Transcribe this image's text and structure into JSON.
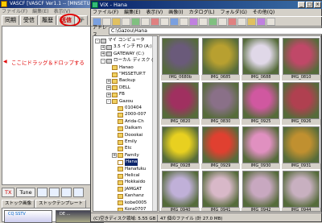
{
  "left_app": {
    "title": "VASCF [VASCF Ver1.1 -- [MNSETUP.TXT] ]",
    "menu": "ファイル(F)　編集(E)　表示(V)",
    "tabs": [
      "同期",
      "受信",
      "履歴",
      "送信",
      "テ"
    ],
    "active_tab": 3,
    "annotation": "ここにドラッグ＆ドロップする",
    "buttons": {
      "tx": "TX",
      "tune": "Tune"
    },
    "bottom_tabs": [
      "ストック画像",
      "ストックテンプレート"
    ],
    "thumb_labels": [
      "CQ SSTV",
      "DE ..."
    ]
  },
  "window": {
    "title": "ViX - Hana",
    "menu": [
      "ファイル(F)",
      "編集(E)",
      "表示(V)",
      "画像(I)",
      "カタログ(L)",
      "フォルダ(G)",
      "その他(Q)"
    ],
    "controls": {
      "minimize": "_",
      "maximize": "□",
      "close": "×"
    },
    "address_label": "アドレス",
    "address": "C:\\Gazou\\Hana"
  },
  "tree": [
    {
      "label": "マイ コンピュータ",
      "depth": 0,
      "expander": "-",
      "type": "drive"
    },
    {
      "label": "3.5 インチ FD (A:)",
      "depth": 1,
      "expander": "+",
      "type": "drive"
    },
    {
      "label": "GATEWAY (C:)",
      "depth": 1,
      "expander": "+",
      "type": "drive"
    },
    {
      "label": "ローカル ディスク (",
      "depth": 1,
      "expander": "-",
      "type": "drive"
    },
    {
      "label": "Hanao",
      "depth": 2,
      "expander": "",
      "type": "folder"
    },
    {
      "label": "\"MSSETUP.T",
      "depth": 2,
      "expander": "",
      "type": "folder"
    },
    {
      "label": "Backup",
      "depth": 2,
      "expander": "+",
      "type": "folder"
    },
    {
      "label": "DELL",
      "depth": 2,
      "expander": "+",
      "type": "folder"
    },
    {
      "label": "FB",
      "depth": 2,
      "expander": "+",
      "type": "folder"
    },
    {
      "label": "Gazou",
      "depth": 2,
      "expander": "-",
      "type": "folder"
    },
    {
      "label": "010404",
      "depth": 3,
      "expander": "",
      "type": "folder"
    },
    {
      "label": "2000-007",
      "depth": 3,
      "expander": "",
      "type": "folder"
    },
    {
      "label": "Arida-Ch",
      "depth": 3,
      "expander": "",
      "type": "folder"
    },
    {
      "label": "Daikam",
      "depth": 3,
      "expander": "",
      "type": "folder"
    },
    {
      "label": "Doookai",
      "depth": 3,
      "expander": "",
      "type": "folder"
    },
    {
      "label": "Emily",
      "depth": 3,
      "expander": "",
      "type": "folder"
    },
    {
      "label": "Etc",
      "depth": 3,
      "expander": "",
      "type": "folder"
    },
    {
      "label": "Family",
      "depth": 3,
      "expander": "+",
      "type": "folder"
    },
    {
      "label": "Hana",
      "depth": 3,
      "expander": "",
      "type": "folder",
      "selected": true
    },
    {
      "label": "Hanafuku",
      "depth": 3,
      "expander": "",
      "type": "folder"
    },
    {
      "label": "Helical",
      "depth": 3,
      "expander": "",
      "type": "folder"
    },
    {
      "label": "Hokkaido",
      "depth": 3,
      "expander": "",
      "type": "folder"
    },
    {
      "label": "JAMGAT",
      "depth": 3,
      "expander": "",
      "type": "folder"
    },
    {
      "label": "Kanhanz",
      "depth": 3,
      "expander": "",
      "type": "folder"
    },
    {
      "label": "kobe0005",
      "depth": 3,
      "expander": "",
      "type": "folder"
    },
    {
      "label": "Kora0707",
      "depth": 3,
      "expander": "",
      "type": "folder"
    }
  ],
  "photos": [
    {
      "caption": "IMG_0680b",
      "color": "#6a5a7a"
    },
    {
      "caption": "IMG_0685",
      "color": "#b8a030"
    },
    {
      "caption": "IMG_0688",
      "color": "#e0d8e8"
    },
    {
      "caption": "IMG_0810",
      "color": "#c04868"
    },
    {
      "caption": "IMG_0820",
      "color": "#a03060"
    },
    {
      "caption": "IMG_0830",
      "color": "#8a7088"
    },
    {
      "caption": "IMG_0925",
      "color": "#d058a0"
    },
    {
      "caption": "IMG_0926",
      "color": "#b04050"
    },
    {
      "caption": "IMG_0928",
      "color": "#e8d020"
    },
    {
      "caption": "IMG_0929",
      "color": "#e04030"
    },
    {
      "caption": "IMG_0930",
      "color": "#e090c0"
    },
    {
      "caption": "IMG_0931",
      "color": "#c09030"
    },
    {
      "caption": "IMG_0940",
      "color": "#c0b0d8"
    },
    {
      "caption": "IMG_0941",
      "color": "#d8b8c8"
    },
    {
      "caption": "IMG_0942",
      "color": "#c8a8c0"
    },
    {
      "caption": "IMG_0944",
      "color": "#c8b0c0"
    }
  ],
  "status": {
    "free_space": "(C)空きディスク領域: 5.55 GB",
    "count": "47 個のファイル (計 27.0 MB)"
  }
}
